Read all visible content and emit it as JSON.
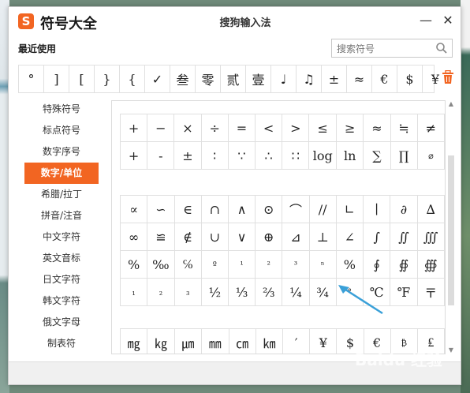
{
  "app": {
    "title": "符号大全",
    "window_title": "搜狗输入法",
    "logo_text": "S"
  },
  "titlebar": {
    "minimize": "—",
    "close": "✕"
  },
  "recent": {
    "label": "最近使用",
    "symbols": [
      "°",
      "]",
      "[",
      "}",
      "{",
      "✓",
      "叁",
      "零",
      "贰",
      "壹",
      "♩",
      "♫",
      "±",
      "≈",
      "€",
      "$",
      "¥"
    ]
  },
  "search": {
    "placeholder": "搜索符号"
  },
  "sidebar": {
    "items": [
      {
        "label": "特殊符号"
      },
      {
        "label": "标点符号"
      },
      {
        "label": "数字序号"
      },
      {
        "label": "数字/单位"
      },
      {
        "label": "希腊/拉丁"
      },
      {
        "label": "拼音/注音"
      },
      {
        "label": "中文字符"
      },
      {
        "label": "英文音标"
      },
      {
        "label": "日文字符"
      },
      {
        "label": "韩文字符"
      },
      {
        "label": "俄文字母"
      },
      {
        "label": "制表符"
      }
    ],
    "active_index": 3
  },
  "grid": {
    "section1": [
      [
        "+",
        "−",
        "×",
        "÷",
        "=",
        "<",
        ">",
        "≤",
        "≥",
        "≈",
        "≒",
        "≠"
      ],
      [
        "+",
        "-",
        "±",
        "∶",
        "∵",
        "∴",
        "∷",
        "log",
        "ln",
        "∑",
        "∏",
        "⌀"
      ]
    ],
    "section2": [
      [
        "∝",
        "∽",
        "∈",
        "∩",
        "∧",
        "⊙",
        "⌒",
        "//",
        "∟",
        "∣",
        "∂",
        "∆"
      ],
      [
        "∞",
        "≌",
        "∉",
        "∪",
        "∨",
        "⊕",
        "⊿",
        "⊥",
        "∠",
        "∫",
        "∬",
        "∭"
      ],
      [
        "%",
        "‰",
        "℅",
        "º",
        "¹",
        "²",
        "³",
        "ⁿ",
        "%",
        "∮",
        "∯",
        "∰"
      ],
      [
        "₁",
        "₂",
        "₃",
        "½",
        "⅓",
        "⅔",
        "¼",
        "¾",
        "°",
        "℃",
        "℉",
        "〒"
      ]
    ],
    "section3": [
      [
        "㎎",
        "㎏",
        "㎛",
        "㎜",
        "㎝",
        "㎞",
        "′",
        "¥",
        "$",
        "€",
        "₿",
        "₤"
      ]
    ]
  },
  "watermark": {
    "text": "Baidu 经验"
  },
  "colors": {
    "accent": "#f26522",
    "arrow": "#3aa0d8"
  }
}
